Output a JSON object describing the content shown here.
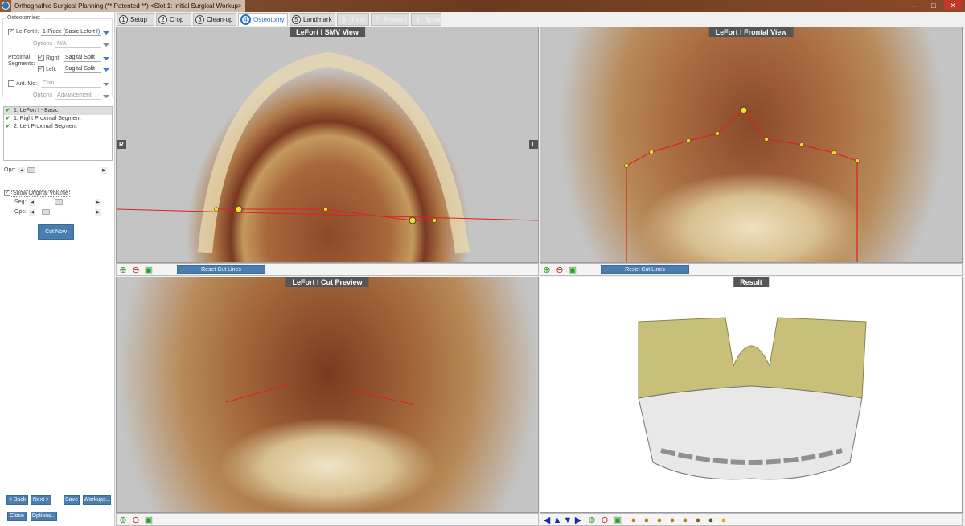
{
  "window": {
    "title": "Orthognathic Surgical Planning (** Patented **) <Slot 1: Initial Surgical Workup>"
  },
  "tabs": [
    {
      "num": "1",
      "label": "Setup"
    },
    {
      "num": "2",
      "label": "Crop"
    },
    {
      "num": "3",
      "label": "Clean-up"
    },
    {
      "num": "4",
      "label": "Osteotomy",
      "active": true
    },
    {
      "num": "5",
      "label": "Landmark"
    },
    {
      "num": "6",
      "label": "Treat",
      "disabled": true
    },
    {
      "num": "7",
      "label": "Present",
      "disabled": true
    },
    {
      "num": "8",
      "label": "Splint",
      "disabled": true
    }
  ],
  "left": {
    "group_label": "Osteotomies:",
    "lefort": {
      "label": "Le Fort I:",
      "checked": true,
      "value": "1-Piece (Basic Lefort I)",
      "options_label": "Options",
      "options_value": "N/A"
    },
    "proximal": {
      "label1": "Proximal",
      "label2": "Segments:",
      "right_label": "Right:",
      "right_checked": true,
      "right_value": "Sagital Split",
      "left_label": "Left:",
      "left_checked": true,
      "left_value": "Sagital Split"
    },
    "ant_md": {
      "label": "Ant. Md:",
      "checked": false,
      "value": "Chin",
      "options_label": "Options",
      "options_value": "Advancement"
    },
    "list": [
      "1: LeFort I - Basic",
      "1: Right Proximal Segment",
      "2: Left Proximal Segment"
    ],
    "opc_label": "Opc:",
    "opc_value": 0.05,
    "show_original": {
      "label": "Show Original Volume",
      "checked": true
    },
    "seg_label": "Seg:",
    "seg_value": 0.5,
    "opc2_label": "Opc:",
    "opc2_value": 0.2,
    "cut_now": "Cut Now",
    "buttons": {
      "back": "< Back",
      "next": "Next >",
      "save": "Save",
      "workups": "Workups...",
      "close": "Close",
      "options": "Options..."
    }
  },
  "views": {
    "smv": {
      "title": "LeFort I SMV View",
      "r": "R",
      "l": "L",
      "reset": "Reset Cut Lines"
    },
    "frontal": {
      "title": "LeFort I Frontal View",
      "reset": "Reset Cut Lines"
    },
    "preview": {
      "title": "LeFort I Cut Preview"
    },
    "result": {
      "title": "Result"
    }
  },
  "icons": [
    "zoom-in-icon",
    "zoom-out-icon",
    "fit-view-icon",
    "arrow-left-icon",
    "arrow-up-icon",
    "arrow-down-icon",
    "arrow-right-icon",
    "head-view-icon"
  ],
  "colors": {
    "accent": "#2a6fc0",
    "button": "#4a7eb0",
    "cut_line": "#e02020",
    "landmark": "#f0e020"
  }
}
